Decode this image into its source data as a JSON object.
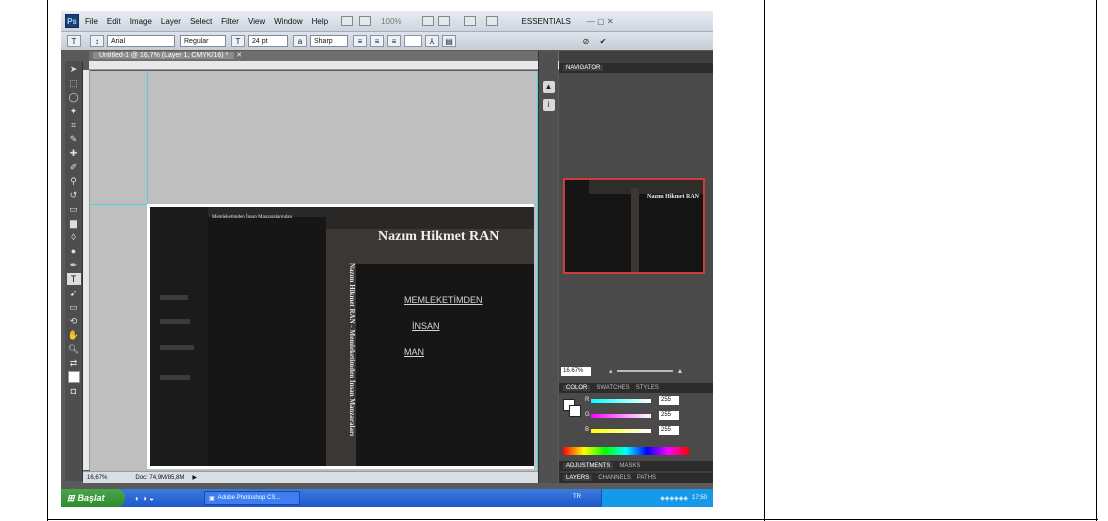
{
  "app": {
    "menu": [
      "File",
      "Edit",
      "Image",
      "Layer",
      "Select",
      "Filter",
      "View",
      "Window",
      "Help"
    ],
    "zoom_menu": "100%",
    "workspace": "ESSENTIALS"
  },
  "options": {
    "font_family": "Arial",
    "font_style": "Regular",
    "font_size": "24 pt",
    "antialias": "Sharp"
  },
  "document": {
    "tab_title": "Untitled-1 @ 16,7% (Layer 1, CMYK/16) *",
    "status_zoom": "16,67%",
    "status_doc": "Doc: 74,9M/85,8M"
  },
  "canvas": {
    "top_small": "Memleketimden İnsan Manzaralarından",
    "vertical_text": "Nazım Hikmet RAN - Memleketimden İnsan Manzaraları",
    "big_title": "Nazım Hikmet RAN",
    "lines": [
      "MEMLEKETİMDEN",
      "İNSAN",
      "MAN"
    ]
  },
  "panels": {
    "navigator_tab": "NAVIGATOR",
    "navigator_zoom": "16.67%",
    "color_tabs": [
      "COLOR",
      "SWATCHES",
      "STYLES"
    ],
    "rgb_values": [
      "255",
      "255",
      "255"
    ],
    "rgb_labels": [
      "R",
      "G",
      "B"
    ],
    "adjust_tabs": [
      "ADJUSTMENTS",
      "MASKS"
    ],
    "layer_tabs": [
      "LAYERS",
      "CHANNELS",
      "PATHS"
    ]
  },
  "taskbar": {
    "start": "Başlat",
    "task": "Adobe Photoshop CS...",
    "lang": "TR",
    "clock": "17:50"
  }
}
